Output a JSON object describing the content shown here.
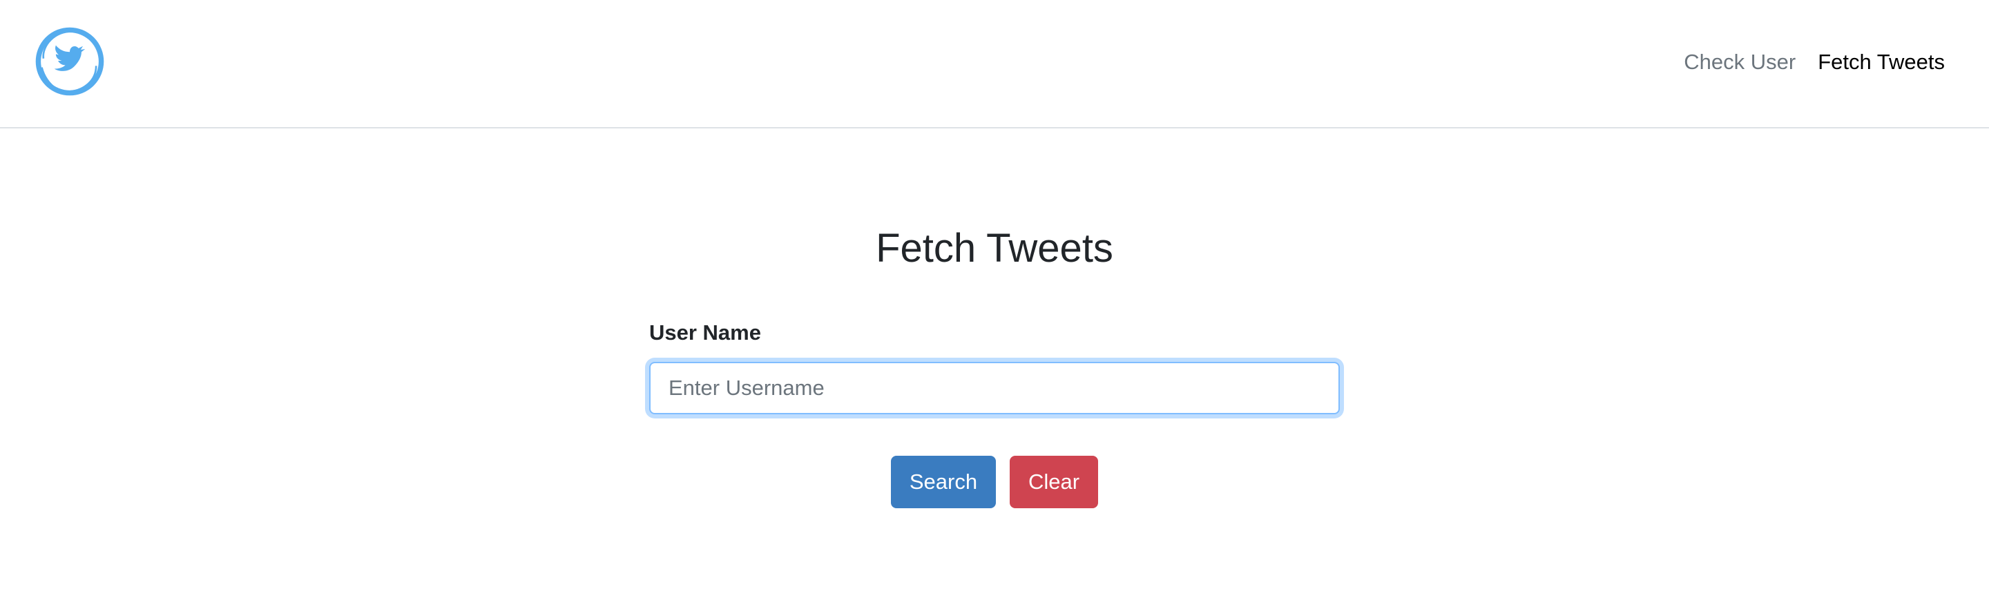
{
  "header": {
    "logo_icon": "twitter-bird-icon",
    "logo_color": "#55acee",
    "nav": [
      {
        "label": "Check User",
        "active": false
      },
      {
        "label": "Fetch Tweets",
        "active": true
      }
    ]
  },
  "main": {
    "title": "Fetch Tweets",
    "form": {
      "label": "User Name",
      "placeholder": "Enter Username",
      "value": ""
    },
    "buttons": {
      "search_label": "Search",
      "clear_label": "Clear",
      "search_color": "#3a7cc0",
      "clear_color": "#cf4450"
    }
  }
}
